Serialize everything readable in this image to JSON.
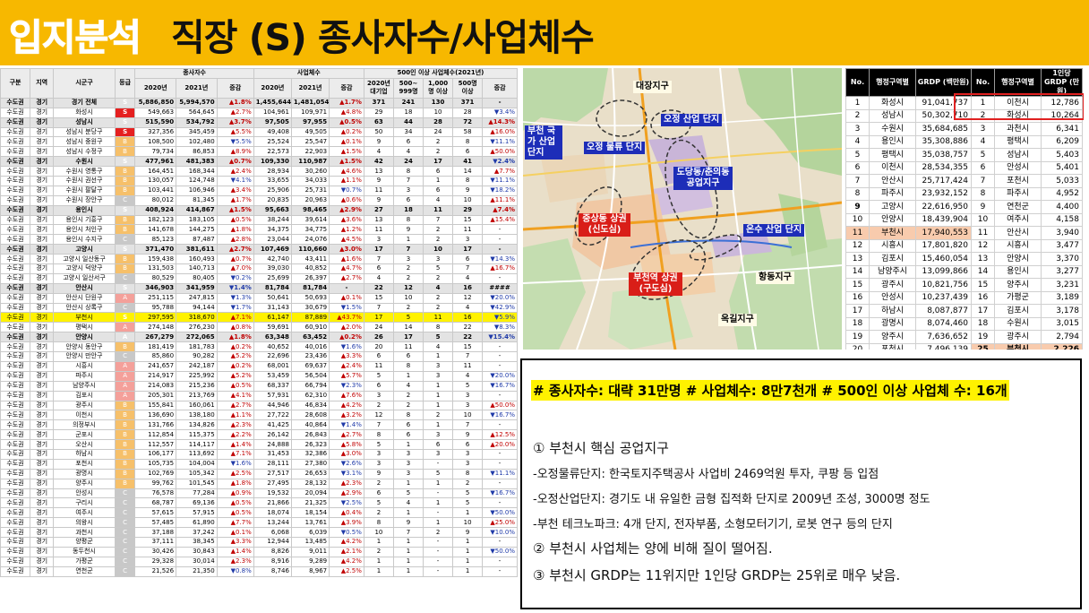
{
  "title": {
    "part1": "입지분석",
    "part2": "직장 (S) 종사자수/사업체수"
  },
  "left_table": {
    "headers": {
      "gubun": "구분",
      "region": "지역",
      "sigungu": "시군구",
      "grade": "등급",
      "emp_group": "종사자수",
      "biz_group": "사업체수",
      "large_group": "500인 이상 사업체수(2021년)",
      "y2020": "2020년",
      "y2021": "2021년",
      "change": "증감",
      "l_2020": "2020년 대기업",
      "l_500": "500~ 999명",
      "l_1000": "1,000명 이상",
      "l_500up": "500명 이상",
      "l_change": "증감"
    },
    "rows": [
      [
        "수도권",
        "경기",
        "경기 전체",
        "S",
        "5,886,850",
        "5,994,570",
        "▲1.8%",
        "1,455,644",
        "1,481,054",
        "▲1.7%",
        "371",
        "241",
        "130",
        "371",
        "-",
        "sub"
      ],
      [
        "수도권",
        "경기",
        "화성시",
        "S",
        "549,663",
        "564,645",
        "▲2.7%",
        "104,961",
        "109,971",
        "▲4.8%",
        "29",
        "18",
        "10",
        "28",
        "▼3.4%",
        ""
      ],
      [
        "수도권",
        "경기",
        "성남시",
        "S",
        "515,590",
        "534,792",
        "▲3.7%",
        "97,505",
        "97,955",
        "▲0.5%",
        "63",
        "44",
        "28",
        "72",
        "▲14.3%",
        "sub"
      ],
      [
        "수도권",
        "경기",
        "성남시 분당구",
        "S",
        "327,356",
        "345,459",
        "▲5.5%",
        "49,408",
        "49,505",
        "▲0.2%",
        "50",
        "34",
        "24",
        "58",
        "▲16.0%",
        ""
      ],
      [
        "수도권",
        "경기",
        "성남시 중원구",
        "B",
        "108,500",
        "102,480",
        "▼5.5%",
        "25,524",
        "25,547",
        "▲0.1%",
        "9",
        "6",
        "2",
        "8",
        "▼11.1%",
        ""
      ],
      [
        "수도권",
        "경기",
        "성남시 수정구",
        "B",
        "79,734",
        "86,853",
        "▲8.9%",
        "22,573",
        "22,903",
        "▲1.5%",
        "4",
        "4",
        "2",
        "6",
        "▲50.0%",
        ""
      ],
      [
        "수도권",
        "경기",
        "수원시",
        "S",
        "477,961",
        "481,383",
        "▲0.7%",
        "109,330",
        "110,987",
        "▲1.5%",
        "42",
        "24",
        "17",
        "41",
        "▼2.4%",
        "sub"
      ],
      [
        "수도권",
        "경기",
        "수원시 영통구",
        "B",
        "164,451",
        "168,344",
        "▲2.4%",
        "28,934",
        "30,260",
        "▲4.6%",
        "13",
        "8",
        "6",
        "14",
        "▲7.7%",
        ""
      ],
      [
        "수도권",
        "경기",
        "수원시 권선구",
        "B",
        "130,057",
        "124,748",
        "▼4.1%",
        "33,655",
        "34,033",
        "▲1.1%",
        "9",
        "7",
        "1",
        "8",
        "▼11.1%",
        ""
      ],
      [
        "수도권",
        "경기",
        "수원시 팔달구",
        "B",
        "103,441",
        "106,946",
        "▲3.4%",
        "25,906",
        "25,731",
        "▼0.7%",
        "11",
        "3",
        "6",
        "9",
        "▼18.2%",
        ""
      ],
      [
        "수도권",
        "경기",
        "수원시 장안구",
        "C",
        "80,012",
        "81,345",
        "▲1.7%",
        "20,835",
        "20,963",
        "▲0.6%",
        "9",
        "6",
        "4",
        "10",
        "▲11.1%",
        ""
      ],
      [
        "수도권",
        "경기",
        "용인시",
        "S",
        "408,924",
        "414,867",
        "▲1.5%",
        "95,663",
        "98,465",
        "▲2.9%",
        "27",
        "18",
        "11",
        "29",
        "▲7.4%",
        "sub"
      ],
      [
        "수도권",
        "경기",
        "용인시 기흥구",
        "B",
        "182,123",
        "183,105",
        "▲0.5%",
        "38,244",
        "39,614",
        "▲3.6%",
        "13",
        "8",
        "7",
        "15",
        "▲15.4%",
        ""
      ],
      [
        "수도권",
        "경기",
        "용인시 처인구",
        "B",
        "141,678",
        "144,275",
        "▲1.8%",
        "34,375",
        "34,775",
        "▲1.2%",
        "11",
        "9",
        "2",
        "11",
        "-",
        ""
      ],
      [
        "수도권",
        "경기",
        "용인시 수지구",
        "C",
        "85,123",
        "87,487",
        "▲2.8%",
        "23,044",
        "24,076",
        "▲4.5%",
        "3",
        "1",
        "2",
        "3",
        "-",
        ""
      ],
      [
        "수도권",
        "경기",
        "고양시",
        "S",
        "371,470",
        "381,611",
        "▲2.7%",
        "107,469",
        "110,660",
        "▲3.0%",
        "17",
        "7",
        "10",
        "17",
        "-",
        "sub"
      ],
      [
        "수도권",
        "경기",
        "고양시 일산동구",
        "B",
        "159,438",
        "160,493",
        "▲0.7%",
        "42,740",
        "43,411",
        "▲1.6%",
        "7",
        "3",
        "3",
        "6",
        "▼14.3%",
        ""
      ],
      [
        "수도권",
        "경기",
        "고양시 덕양구",
        "B",
        "131,503",
        "140,713",
        "▲7.0%",
        "39,030",
        "40,852",
        "▲4.7%",
        "6",
        "2",
        "5",
        "7",
        "▲16.7%",
        ""
      ],
      [
        "수도권",
        "경기",
        "고양시 일산서구",
        "C",
        "80,529",
        "80,405",
        "▼0.2%",
        "25,699",
        "26,397",
        "▲2.7%",
        "4",
        "2",
        "2",
        "4",
        "-",
        ""
      ],
      [
        "수도권",
        "경기",
        "안산시",
        "S",
        "346,903",
        "341,959",
        "▼1.4%",
        "81,784",
        "81,784",
        "-",
        "22",
        "12",
        "4",
        "16",
        "####",
        "sub"
      ],
      [
        "수도권",
        "경기",
        "안산시 단원구",
        "A",
        "251,115",
        "247,815",
        "▼1.3%",
        "50,641",
        "50,693",
        "▲0.1%",
        "15",
        "10",
        "2",
        "12",
        "▼20.0%",
        ""
      ],
      [
        "수도권",
        "경기",
        "안산시 상록구",
        "C",
        "95,788",
        "94,144",
        "▼1.7%",
        "31,143",
        "30,679",
        "▼1.5%",
        "7",
        "2",
        "2",
        "4",
        "▼42.9%",
        ""
      ],
      [
        "수도권",
        "경기",
        "부천시",
        "S",
        "297,595",
        "318,670",
        "▲7.1%",
        "61,147",
        "87,889",
        "▲43.7%",
        "17",
        "5",
        "11",
        "16",
        "▼5.9%",
        "hl"
      ],
      [
        "수도권",
        "경기",
        "평택시",
        "A",
        "274,148",
        "276,230",
        "▲0.8%",
        "59,691",
        "60,910",
        "▲2.0%",
        "24",
        "14",
        "8",
        "22",
        "▼8.3%",
        ""
      ],
      [
        "수도권",
        "경기",
        "안양시",
        "A",
        "267,279",
        "272,065",
        "▲1.8%",
        "63,348",
        "63,452",
        "▲0.2%",
        "26",
        "17",
        "5",
        "22",
        "▼15.4%",
        "sub"
      ],
      [
        "수도권",
        "경기",
        "안양시 동안구",
        "B",
        "181,419",
        "181,783",
        "▲0.2%",
        "40,652",
        "40,016",
        "▼1.6%",
        "20",
        "11",
        "4",
        "15",
        "-",
        ""
      ],
      [
        "수도권",
        "경기",
        "안양시 만안구",
        "C",
        "85,860",
        "90,282",
        "▲5.2%",
        "22,696",
        "23,436",
        "▲3.3%",
        "6",
        "6",
        "1",
        "7",
        "-",
        ""
      ],
      [
        "수도권",
        "경기",
        "시흥시",
        "A",
        "241,657",
        "242,187",
        "▲0.2%",
        "68,001",
        "69,637",
        "▲2.4%",
        "11",
        "8",
        "3",
        "11",
        "-",
        ""
      ],
      [
        "수도권",
        "경기",
        "파주시",
        "A",
        "214,917",
        "225,992",
        "▲5.2%",
        "53,459",
        "56,504",
        "▲5.7%",
        "5",
        "1",
        "3",
        "4",
        "▼20.0%",
        ""
      ],
      [
        "수도권",
        "경기",
        "남양주시",
        "A",
        "214,083",
        "215,236",
        "▲0.5%",
        "68,337",
        "66,794",
        "▼2.3%",
        "6",
        "4",
        "1",
        "5",
        "▼16.7%",
        ""
      ],
      [
        "수도권",
        "경기",
        "김포시",
        "A",
        "205,301",
        "213,769",
        "▲4.1%",
        "57,931",
        "62,310",
        "▲7.6%",
        "3",
        "2",
        "1",
        "3",
        "-",
        ""
      ],
      [
        "수도권",
        "경기",
        "광주시",
        "B",
        "155,841",
        "160,061",
        "▲2.7%",
        "44,946",
        "46,834",
        "▲4.2%",
        "2",
        "2",
        "1",
        "3",
        "▲50.0%",
        ""
      ],
      [
        "수도권",
        "경기",
        "이천시",
        "B",
        "136,690",
        "138,180",
        "▲1.1%",
        "27,722",
        "28,608",
        "▲3.2%",
        "12",
        "8",
        "2",
        "10",
        "▼16.7%",
        ""
      ],
      [
        "수도권",
        "경기",
        "의정부시",
        "B",
        "131,766",
        "134,826",
        "▲2.3%",
        "41,425",
        "40,864",
        "▼1.4%",
        "7",
        "6",
        "1",
        "7",
        "-",
        ""
      ],
      [
        "수도권",
        "경기",
        "군포시",
        "B",
        "112,854",
        "115,375",
        "▲2.2%",
        "26,142",
        "26,843",
        "▲2.7%",
        "8",
        "6",
        "3",
        "9",
        "▲12.5%",
        ""
      ],
      [
        "수도권",
        "경기",
        "오산시",
        "B",
        "112,557",
        "114,117",
        "▲1.4%",
        "24,888",
        "26,323",
        "▲5.8%",
        "5",
        "1",
        "6",
        "6",
        "▲20.0%",
        ""
      ],
      [
        "수도권",
        "경기",
        "하남시",
        "B",
        "106,177",
        "113,692",
        "▲7.1%",
        "31,453",
        "32,386",
        "▲3.0%",
        "3",
        "3",
        "3",
        "3",
        "-",
        ""
      ],
      [
        "수도권",
        "경기",
        "포천시",
        "B",
        "105,735",
        "104,004",
        "▼1.6%",
        "28,111",
        "27,380",
        "▼2.6%",
        "3",
        "3",
        "-",
        "3",
        "-",
        ""
      ],
      [
        "수도권",
        "경기",
        "광명시",
        "B",
        "102,769",
        "105,342",
        "▲2.5%",
        "27,517",
        "26,653",
        "▼3.1%",
        "9",
        "3",
        "5",
        "8",
        "▼11.1%",
        ""
      ],
      [
        "수도권",
        "경기",
        "양주시",
        "B",
        "99,762",
        "101,545",
        "▲1.8%",
        "27,495",
        "28,132",
        "▲2.3%",
        "2",
        "1",
        "1",
        "2",
        "-",
        ""
      ],
      [
        "수도권",
        "경기",
        "안성시",
        "C",
        "76,578",
        "77,284",
        "▲0.9%",
        "19,532",
        "20,094",
        "▲2.9%",
        "6",
        "5",
        "-",
        "5",
        "▼16.7%",
        ""
      ],
      [
        "수도권",
        "경기",
        "구리시",
        "C",
        "68,787",
        "69,136",
        "▲0.5%",
        "21,866",
        "21,325",
        "▼2.5%",
        "5",
        "4",
        "1",
        "5",
        "-",
        ""
      ],
      [
        "수도권",
        "경기",
        "여주시",
        "C",
        "57,615",
        "57,915",
        "▲0.5%",
        "18,074",
        "18,154",
        "▲0.4%",
        "2",
        "1",
        "-",
        "1",
        "▼50.0%",
        ""
      ],
      [
        "수도권",
        "경기",
        "의왕시",
        "C",
        "57,485",
        "61,890",
        "▲7.7%",
        "13,244",
        "13,761",
        "▲3.9%",
        "8",
        "9",
        "1",
        "10",
        "▲25.0%",
        ""
      ],
      [
        "수도권",
        "경기",
        "과천시",
        "C",
        "37,188",
        "37,242",
        "▲0.1%",
        "6,068",
        "6,039",
        "▼0.5%",
        "10",
        "7",
        "2",
        "9",
        "▼10.0%",
        ""
      ],
      [
        "수도권",
        "경기",
        "양평군",
        "C",
        "37,111",
        "38,345",
        "▲3.3%",
        "12,944",
        "13,485",
        "▲4.2%",
        "1",
        "1",
        "-",
        "1",
        "-",
        ""
      ],
      [
        "수도권",
        "경기",
        "동두천시",
        "C",
        "30,426",
        "30,843",
        "▲1.4%",
        "8,826",
        "9,011",
        "▲2.1%",
        "2",
        "1",
        "-",
        "1",
        "▼50.0%",
        ""
      ],
      [
        "수도권",
        "경기",
        "가평군",
        "C",
        "29,328",
        "30,014",
        "▲2.3%",
        "8,916",
        "9,289",
        "▲4.2%",
        "1",
        "1",
        "-",
        "1",
        "-",
        ""
      ],
      [
        "수도권",
        "경기",
        "연천군",
        "C",
        "21,526",
        "21,350",
        "▼0.8%",
        "8,746",
        "8,967",
        "▲2.5%",
        "1",
        "1",
        "-",
        "1",
        "-",
        ""
      ]
    ]
  },
  "map": {
    "labels": {
      "daejang": "대장지구",
      "bucheon_industrial": "부천 국가 산업 단지",
      "ojeong_industrial": "오정 산업 단지",
      "ojeong_logistics": "오정 물류 단지",
      "dodang": "도당동/춘의동 공업지구",
      "jungsang": "중상동 상권 (신도심)",
      "onsu": "온수 산업 단지",
      "station": "부천역 상권 (구도심)",
      "hangdong": "항동지구",
      "okgil": "옥길지구"
    }
  },
  "grdp_table": {
    "headers": [
      "No.",
      "행정구역별",
      "GRDP (백만원)",
      "No.",
      "행정구역별",
      "1인당GRDP (만원)"
    ],
    "rows": [
      [
        "1",
        "화성시",
        "91,041,737",
        "1",
        "이천시",
        "12,786"
      ],
      [
        "2",
        "성남시",
        "50,302,710",
        "2",
        "화성시",
        "10,264"
      ],
      [
        "3",
        "수원시",
        "35,684,685",
        "3",
        "과천시",
        "6,341"
      ],
      [
        "4",
        "용인시",
        "35,308,886",
        "4",
        "평택시",
        "6,209"
      ],
      [
        "5",
        "평택시",
        "35,038,757",
        "5",
        "성남시",
        "5,403"
      ],
      [
        "6",
        "이천시",
        "28,534,355",
        "6",
        "안성시",
        "5,401"
      ],
      [
        "7",
        "안산시",
        "25,717,424",
        "7",
        "포천시",
        "5,033"
      ],
      [
        "8",
        "파주시",
        "23,932,152",
        "8",
        "파주시",
        "4,952"
      ],
      [
        "9",
        "고양시",
        "22,616,950",
        "9",
        "연천군",
        "4,400"
      ],
      [
        "10",
        "안양시",
        "18,439,904",
        "10",
        "여주시",
        "4,158"
      ],
      [
        "11",
        "부천시",
        "17,940,553",
        "11",
        "안산시",
        "3,940"
      ],
      [
        "12",
        "시흥시",
        "17,801,820",
        "12",
        "시흥시",
        "3,477"
      ],
      [
        "13",
        "김포시",
        "15,460,054",
        "13",
        "안양시",
        "3,370"
      ],
      [
        "14",
        "남양주시",
        "13,099,866",
        "14",
        "용인시",
        "3,277"
      ],
      [
        "15",
        "광주시",
        "10,821,756",
        "15",
        "양주시",
        "3,231"
      ],
      [
        "16",
        "안성시",
        "10,237,439",
        "16",
        "가평군",
        "3,189"
      ],
      [
        "17",
        "하남시",
        "8,087,877",
        "17",
        "김포시",
        "3,178"
      ],
      [
        "18",
        "광명시",
        "8,074,460",
        "18",
        "수원시",
        "3,015"
      ],
      [
        "19",
        "양주시",
        "7,636,652",
        "19",
        "광주시",
        "2,794"
      ],
      [
        "20",
        "포천시",
        "7,496,139",
        "25",
        "부천시",
        "2,226"
      ]
    ]
  },
  "notes": {
    "highlight": "# 종사자수: 대략 31만명 # 사업체수: 8만7천개 # 500인 이상 사업체 수: 16개",
    "item1": "① 부천시 핵심 공업지구",
    "item1_a": "-오정물류단지: 한국토지주택공사 사업비 2469억원 투자, 쿠팡 등 입점",
    "item1_b": "-오정산업단지: 경기도 내 유일한 금형 집적화 단지로 2009년 조성, 3000명 정도",
    "item1_c": "-부천 테크노파크: 4개 단지, 전자부품, 소형모터기기, 로봇 연구 등의 단지",
    "item2": "② 부천시 사업체는 양에 비해 질이 떨어짐.",
    "item3": "③ 부천시 GRDP는 11위지만 1인당 GRDP는 25위로 매우 낮음."
  },
  "colors": {
    "title_bg": "#f7b800",
    "grade_S": "#e52020",
    "grade_A": "#f4a09a",
    "grade_B": "#f6c06a",
    "grade_C": "#c8c8c8",
    "highlight": "#fff200",
    "accent_red": "#e02020"
  }
}
